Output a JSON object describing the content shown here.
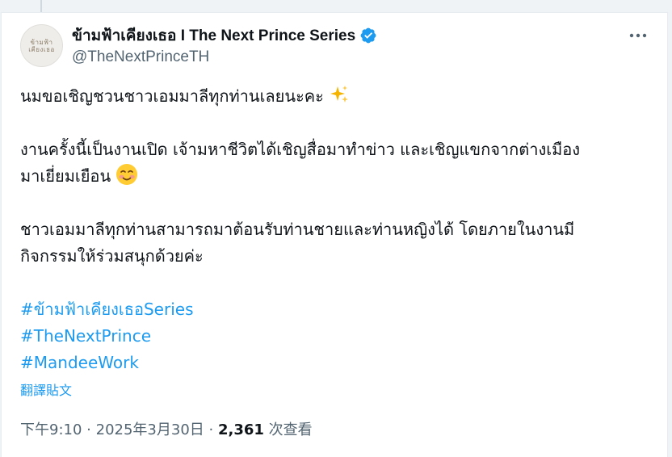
{
  "author": {
    "display_name": "ข้ามฟ้าเคียงเธอ I The Next Prince Series",
    "handle": "@TheNextPrinceTH",
    "avatar_text_line1": "ข้ามฟ้า",
    "avatar_text_line2": "เคียงเธอ",
    "verified": true
  },
  "tweet": {
    "para1": "นมขอเชิญชวนชาวเอมมาลีทุกท่านเลยนะคะ",
    "para2_line1": "งานครั้งนี้เป็นงานเปิด เจ้ามหาชีวิตได้เชิญสื่อมาทำข่าว และเชิญแขกจากต่างเมือง",
    "para2_line2": "มาเยี่ยมเยือน",
    "para3_line1": "ชาวเอมมาลีทุกท่านสามารถมาต้อนรับท่านชายและท่านหญิงได้ โดยภายในงานมี",
    "para3_line2": "กิจกรรมให้ร่วมสนุกด้วยค่ะ",
    "hashtags": [
      "#ข้ามฟ้าเคียงเธอSeries",
      "#TheNextPrince",
      "#MandeeWork"
    ],
    "translate_label": "翻譯貼文"
  },
  "meta": {
    "time": "下午9:10",
    "date": "2025年3月30日",
    "separator": "·",
    "views_count": "2,361",
    "views_label": "次查看"
  },
  "icons": {
    "verified": "verified-badge-icon",
    "more": "more-options-icon",
    "sparkles": "sparkles-emoji",
    "blush": "smiling-face-emoji"
  },
  "colors": {
    "accent": "#1d9bf0",
    "text_primary": "#0f1419",
    "text_secondary": "#536471"
  }
}
